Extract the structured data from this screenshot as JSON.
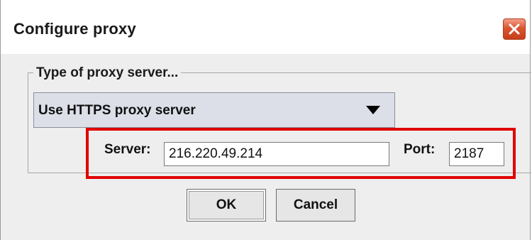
{
  "window": {
    "title": "Configure proxy",
    "close_icon": "close-icon",
    "close_color": "#d9552f"
  },
  "group": {
    "legend": "Type of proxy server..."
  },
  "proxy_type": {
    "selected": "Use HTTPS proxy server",
    "arrow_icon": "triangle-down-icon"
  },
  "server": {
    "label": "Server:",
    "value": "216.220.49.214"
  },
  "port": {
    "label": "Port:",
    "value": "2187"
  },
  "buttons": {
    "ok": "OK",
    "cancel": "Cancel"
  },
  "annotation": {
    "highlight_color": "#e00000"
  }
}
